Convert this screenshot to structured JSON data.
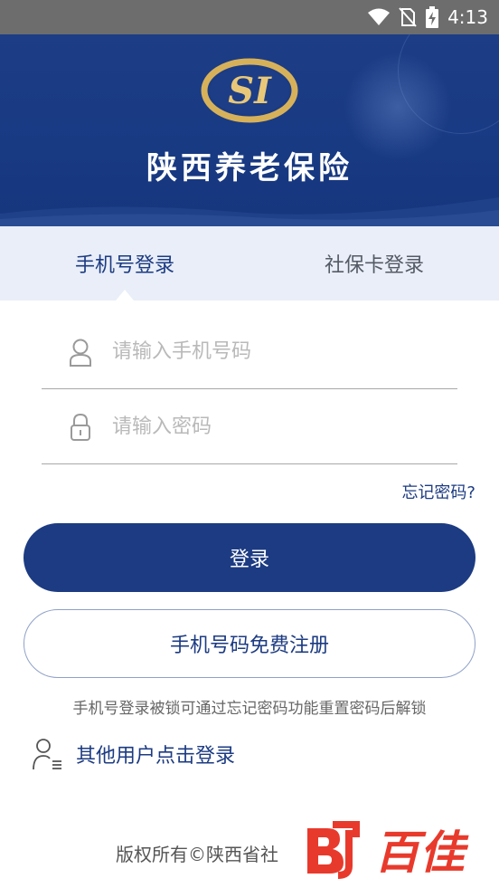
{
  "status_bar": {
    "time": "4:13"
  },
  "header": {
    "title": "陕西养老保险",
    "logo_text": "SI"
  },
  "tabs": [
    {
      "label": "手机号登录",
      "active": true
    },
    {
      "label": "社保卡登录",
      "active": false
    }
  ],
  "form": {
    "phone_placeholder": "请输入手机号码",
    "password_placeholder": "请输入密码",
    "forgot_password": "忘记密码?",
    "login_label": "登录",
    "register_label": "手机号码免费注册",
    "hint": "手机号登录被锁可通过忘记密码功能重置密码后解锁",
    "other_login": "其他用户点击登录"
  },
  "footer": {
    "copyright": "版权所有©陕西省社",
    "watermark_text": "百佳"
  },
  "colors": {
    "brand": "#1c3b82",
    "tab_bg": "#e9eef8",
    "status_bar": "#6d6d6d",
    "watermark": "#e83a2c"
  }
}
